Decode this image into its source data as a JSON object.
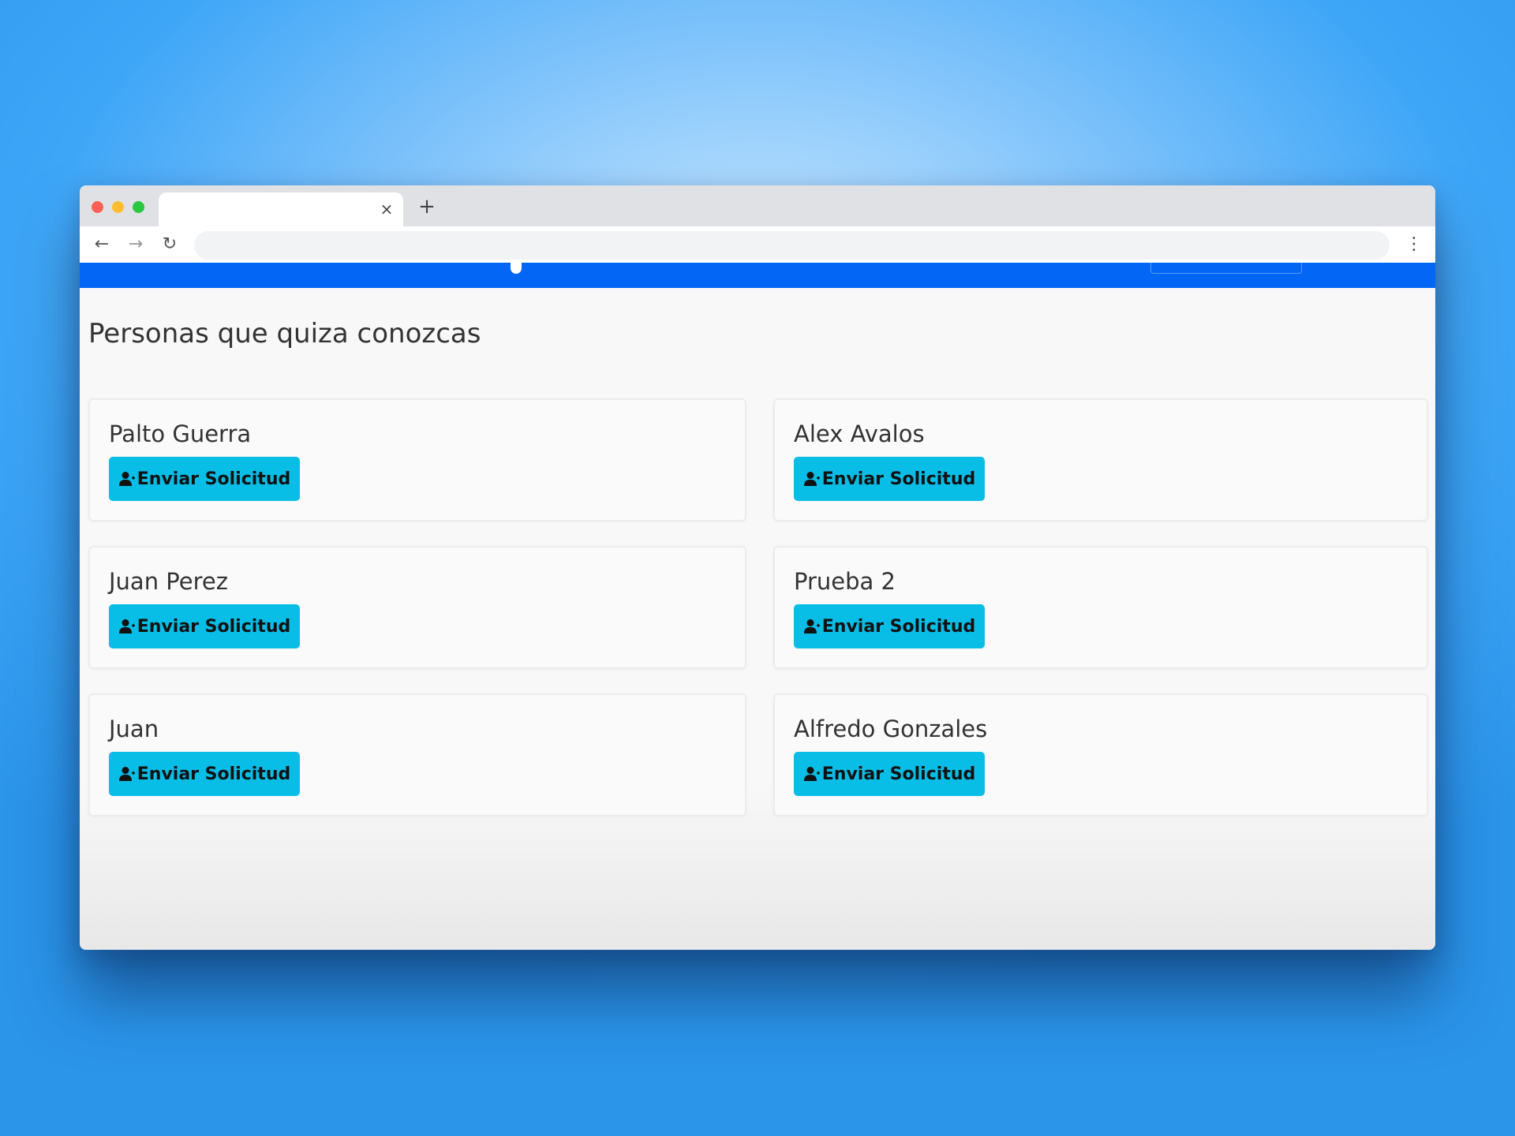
{
  "browser": {
    "tab_title": "",
    "tab_close_glyph": "×",
    "new_tab_glyph": "+",
    "back_glyph": "←",
    "forward_glyph": "→",
    "reload_glyph": "↻",
    "menu_glyph": "⋮",
    "url": ""
  },
  "page": {
    "title": "Personas que quiza conozcas",
    "accent_color": "#0366f5",
    "button_color": "#08bde6"
  },
  "suggestions": [
    {
      "name": "Palto Guerra",
      "button_label": "Enviar Solicitud",
      "icon": "user-plus-icon"
    },
    {
      "name": "Alex Avalos",
      "button_label": "Enviar Solicitud",
      "icon": "user-plus-icon"
    },
    {
      "name": "Juan Perez",
      "button_label": "Enviar Solicitud",
      "icon": "user-plus-icon"
    },
    {
      "name": "Prueba 2",
      "button_label": "Enviar Solicitud",
      "icon": "user-plus-icon"
    },
    {
      "name": "Juan",
      "button_label": "Enviar Solicitud",
      "icon": "user-plus-icon"
    },
    {
      "name": "Alfredo Gonzales",
      "button_label": "Enviar Solicitud",
      "icon": "user-plus-icon"
    }
  ]
}
